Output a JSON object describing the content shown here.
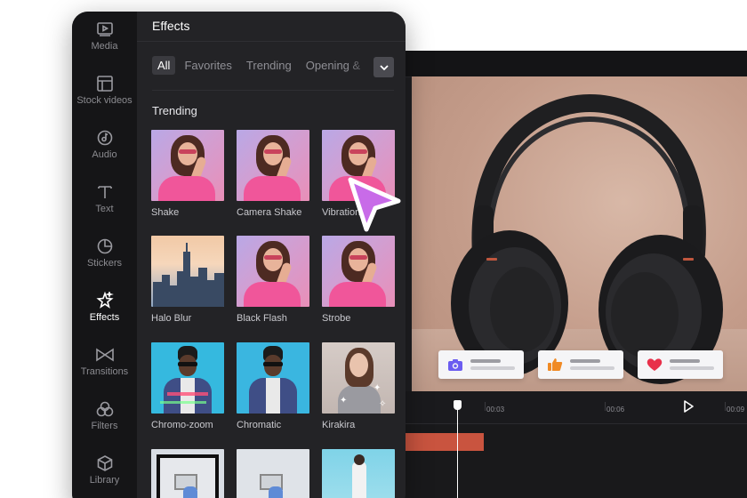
{
  "panel": {
    "title": "Effects",
    "tabs": [
      {
        "label": "All",
        "active": true
      },
      {
        "label": "Favorites",
        "active": false
      },
      {
        "label": "Trending",
        "active": false
      },
      {
        "label": "Opening &",
        "active": false
      }
    ],
    "more_icon": "chevron-down-icon",
    "section_title": "Trending",
    "items": [
      {
        "label": "Shake",
        "thumb": "woman-pink"
      },
      {
        "label": "Camera Shake",
        "thumb": "woman-pink"
      },
      {
        "label": "Vibration",
        "thumb": "woman-pink"
      },
      {
        "label": "Halo Blur",
        "thumb": "city"
      },
      {
        "label": "Black Flash",
        "thumb": "woman-pink"
      },
      {
        "label": "Strobe",
        "thumb": "woman-pink"
      },
      {
        "label": "Chromo-zoom",
        "thumb": "man-blue"
      },
      {
        "label": "Chromatic",
        "thumb": "man-blue"
      },
      {
        "label": "Kirakira",
        "thumb": "woman-sparkle"
      },
      {
        "label": "",
        "thumb": "room"
      },
      {
        "label": "",
        "thumb": "room"
      },
      {
        "label": "",
        "thumb": "skate"
      }
    ]
  },
  "sidebar": {
    "items": [
      {
        "label": "Media",
        "icon": "media-icon",
        "active": false
      },
      {
        "label": "Stock videos",
        "icon": "stock-videos-icon",
        "active": false
      },
      {
        "label": "Audio",
        "icon": "audio-icon",
        "active": false
      },
      {
        "label": "Text",
        "icon": "text-icon",
        "active": false
      },
      {
        "label": "Stickers",
        "icon": "stickers-icon",
        "active": false
      },
      {
        "label": "Effects",
        "icon": "effects-icon",
        "active": true
      },
      {
        "label": "Transitions",
        "icon": "transitions-icon",
        "active": false
      },
      {
        "label": "Filters",
        "icon": "filters-icon",
        "active": false
      },
      {
        "label": "Library",
        "icon": "library-icon",
        "active": false
      }
    ]
  },
  "preview": {
    "reactions": [
      {
        "icon": "camera-icon",
        "color": "#6b5cf0"
      },
      {
        "icon": "thumbs-up-icon",
        "color": "#f08a24"
      },
      {
        "icon": "heart-icon",
        "color": "#e8304a"
      }
    ]
  },
  "timeline": {
    "ticks": [
      "00:03",
      "00:06",
      "00:09"
    ],
    "clip_color": "#c9543f"
  },
  "colors": {
    "cursor": "#c86be8",
    "panel_bg": "#232326",
    "sidebar_bg": "#151517"
  }
}
